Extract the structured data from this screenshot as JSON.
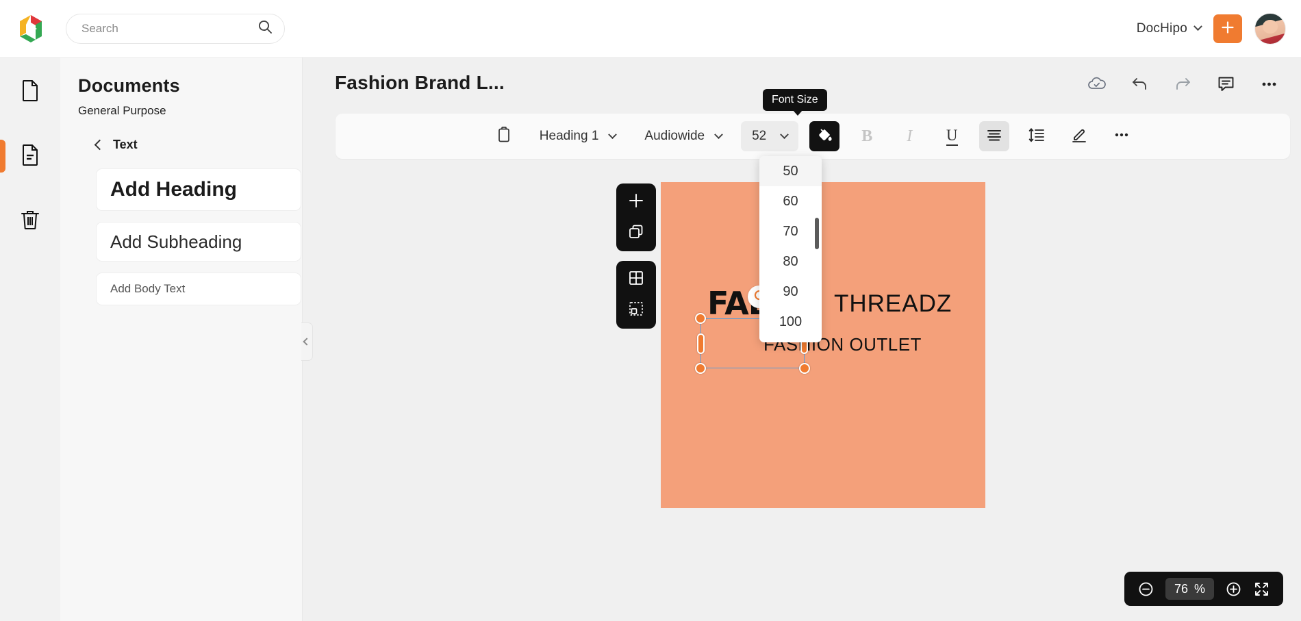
{
  "topbar": {
    "logo_icon": "dochipo-logo-icon",
    "search": {
      "placeholder": "Search",
      "value": "",
      "icon": "search-icon"
    },
    "brand_name": "DocHipo",
    "brand_chevron_icon": "chevron-down-icon",
    "create_label": "+",
    "create_icon": "plus-icon",
    "avatar_icon": "user-avatar"
  },
  "rail": {
    "items": [
      {
        "name": "blank-page",
        "icon": "page-icon",
        "active": false
      },
      {
        "name": "documents",
        "icon": "document-text-icon",
        "active": true
      },
      {
        "name": "trash",
        "icon": "trash-icon",
        "active": false
      }
    ]
  },
  "panel": {
    "title": "Documents",
    "subtitle": "General Purpose",
    "back_label": "Text",
    "back_icon": "chevron-left-icon",
    "text_options": [
      {
        "label": "Add Heading"
      },
      {
        "label": "Add Subheading"
      },
      {
        "label": "Add Body Text"
      }
    ],
    "collapse_icon": "chevron-left-icon"
  },
  "editor": {
    "doc_title": "Fashion Brand L...",
    "actions": [
      {
        "name": "cloud-saved",
        "icon": "cloud-check-icon"
      },
      {
        "name": "undo",
        "icon": "undo-arrow-icon"
      },
      {
        "name": "redo",
        "icon": "redo-arrow-icon"
      },
      {
        "name": "comments",
        "icon": "comment-icon"
      },
      {
        "name": "more-options",
        "icon": "ellipsis-icon"
      }
    ]
  },
  "toolbar": {
    "clipboard_icon": "clipboard-icon",
    "style_select": {
      "value": "Heading 1",
      "icon": "chevron-down-icon"
    },
    "font_select": {
      "value": "Audiowide",
      "icon": "chevron-down-icon"
    },
    "fontsize_select": {
      "value": "52",
      "icon": "chevron-down-icon"
    },
    "fill_color": {
      "icon": "paint-bucket-icon",
      "active": true
    },
    "bold": {
      "label": "B",
      "icon": "bold-icon"
    },
    "italic": {
      "label": "I",
      "icon": "italic-icon"
    },
    "underline": {
      "label": "U",
      "icon": "underline-icon"
    },
    "align": {
      "icon": "align-center-icon",
      "active": true
    },
    "line_spacing": {
      "icon": "line-height-icon"
    },
    "highlighter": {
      "icon": "marker-pen-icon"
    },
    "more": {
      "icon": "ellipsis-icon"
    },
    "tooltip": "Font Size"
  },
  "fontsize_dropdown": {
    "options": [
      "50",
      "60",
      "70",
      "80",
      "90",
      "100"
    ],
    "highlighted": "50"
  },
  "canvas": {
    "background_color": "#F4A07A",
    "texts": [
      {
        "name": "logo-fab-text",
        "value": "FAB"
      },
      {
        "name": "brand-threadz-text",
        "value": "THREADZ"
      },
      {
        "name": "tagline-text",
        "value": "FASHION OUTLET"
      }
    ]
  },
  "page_tools": {
    "groups": [
      [
        {
          "name": "add-page",
          "icon": "plus-icon"
        },
        {
          "name": "duplicate-page",
          "icon": "copy-icon"
        }
      ],
      [
        {
          "name": "grid-layout",
          "icon": "grid-icon"
        },
        {
          "name": "position-snap",
          "icon": "selection-box-icon"
        }
      ]
    ]
  },
  "selection": {
    "rotate_icon": "rotate-icon",
    "handles": [
      "top-left",
      "bottom-left",
      "bottom-right",
      "left-middle",
      "right-middle"
    ]
  },
  "zoombar": {
    "zoom_out_icon": "minus-circle-icon",
    "zoom_value": "76",
    "zoom_unit": "%",
    "zoom_in_icon": "plus-circle-icon",
    "fullscreen_icon": "expand-icon"
  },
  "colors": {
    "accent": "#F07B30",
    "canvas": "#F4A07A",
    "selection": "#5B9BD5"
  }
}
